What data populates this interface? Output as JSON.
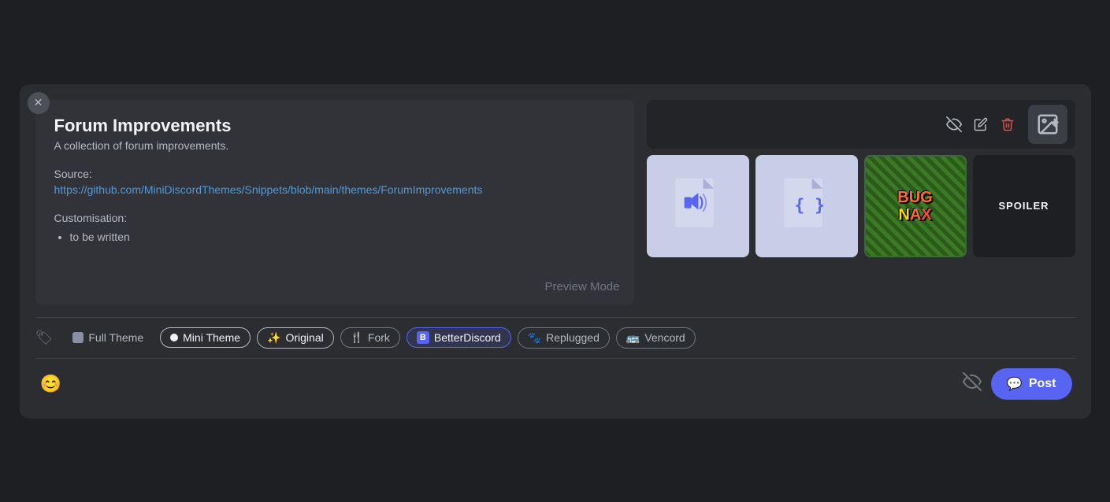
{
  "card": {
    "title": "Forum Improvements",
    "subtitle": "A collection of forum improvements.",
    "source_label": "Source:",
    "source_url": "https://github.com/MiniDiscordThemes/Snippets/blob/main/themes/ForumImprovements",
    "customisation_label": "Customisation:",
    "customisation_items": [
      "to be written"
    ],
    "preview_mode": "Preview Mode"
  },
  "toolbar": {
    "hide_icon": "👁",
    "pencil_icon": "✏",
    "delete_icon": "🗑",
    "add_image_label": "🖼+"
  },
  "attachments": [
    {
      "type": "audio",
      "label": "audio file"
    },
    {
      "type": "css",
      "label": "CSS file"
    },
    {
      "type": "bugsnax",
      "label": "Bug Snax"
    },
    {
      "type": "spoiler",
      "label": "SPOILER"
    }
  ],
  "tags": {
    "icon": "🏷",
    "items": [
      {
        "id": "full-theme",
        "label": "Full Theme",
        "color": "#8a8fa8"
      },
      {
        "id": "mini-theme",
        "label": "Mini Theme",
        "active": true
      },
      {
        "id": "original",
        "label": "Original",
        "emoji": "✨"
      },
      {
        "id": "fork",
        "label": "Fork",
        "emoji": "🍴"
      },
      {
        "id": "betterdiscord",
        "label": "BetterDiscord",
        "prefix": "B"
      },
      {
        "id": "replugged",
        "label": "Replugged",
        "emoji": "🐾"
      },
      {
        "id": "vencord",
        "label": "Vencord",
        "emoji": "🚌"
      }
    ]
  },
  "bottom": {
    "emoji_icon": "😊",
    "post_label": "Post"
  }
}
